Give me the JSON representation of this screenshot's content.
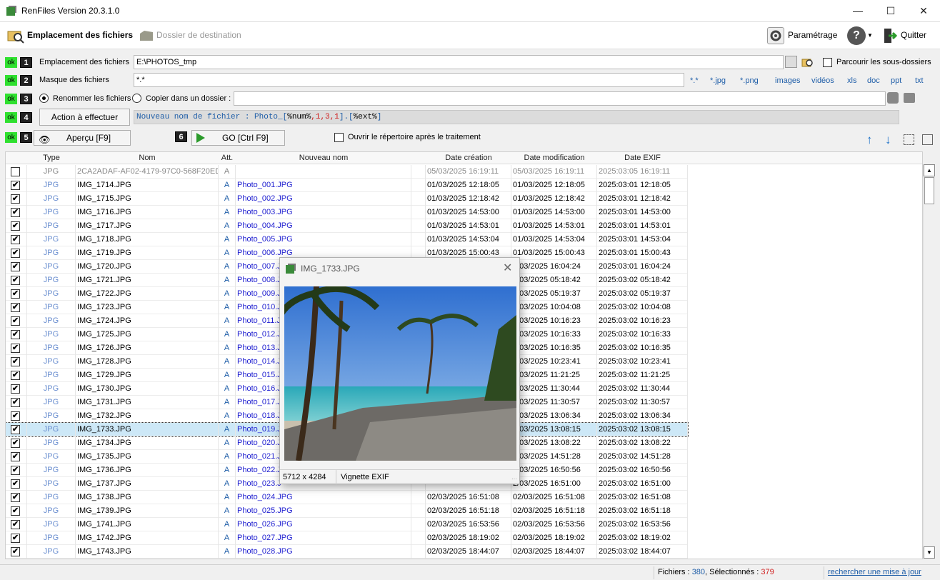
{
  "title": "RenFiles Version 20.3.1.0",
  "toolbar": {
    "location": "Emplacement des fichiers",
    "destination": "Dossier de destination",
    "settings": "Paramétrage",
    "quit": "Quitter"
  },
  "form": {
    "ok": "ok",
    "n1": "1",
    "n2": "2",
    "n3": "3",
    "n4": "4",
    "n5": "5",
    "n6": "6",
    "location_label": "Emplacement des fichiers",
    "location_value": "E:\\PHOTOS_tmp",
    "subfolders": "Parcourir les sous-dossiers",
    "mask_label": "Masque des fichiers",
    "mask_value": "*.*",
    "rename": "Renommer les fichiers",
    "copy": "Copier dans un dossier :",
    "action": "Action à effectuer",
    "formula_prefix": "Nouveau nom de fichier : Photo_[",
    "formula_num": "%num%",
    "formula_args": ",1,3,1",
    "formula_mid": "].[",
    "formula_ext": "%ext%",
    "formula_end": "]",
    "preview": "Aperçu [F9]",
    "go": "GO [Ctrl F9]",
    "open_dir": "Ouvrir le répertoire après le traitement"
  },
  "ext_filters": [
    "*.*",
    "*.jpg",
    "*.png",
    "images",
    "vidéos",
    "xls",
    "doc",
    "ppt",
    "txt"
  ],
  "columns": {
    "type": "Type",
    "name": "Nom",
    "att": "Att.",
    "new": "Nouveau nom",
    "created": "Date création",
    "modified": "Date modification",
    "exif": "Date EXIF"
  },
  "rows": [
    {
      "checked": false,
      "type": "JPG",
      "name": "2CA2ADAF-AF02-4179-97C0-568F20ED4I",
      "att": "A",
      "new": "",
      "created": "05/03/2025 16:19:11",
      "modified": "05/03/2025 16:19:11",
      "exif": "2025:03:05 16:19:11"
    },
    {
      "checked": true,
      "type": "JPG",
      "name": "IMG_1714.JPG",
      "att": "A",
      "new": "Photo_001.JPG",
      "created": "01/03/2025 12:18:05",
      "modified": "01/03/2025 12:18:05",
      "exif": "2025:03:01 12:18:05"
    },
    {
      "checked": true,
      "type": "JPG",
      "name": "IMG_1715.JPG",
      "att": "A",
      "new": "Photo_002.JPG",
      "created": "01/03/2025 12:18:42",
      "modified": "01/03/2025 12:18:42",
      "exif": "2025:03:01 12:18:42"
    },
    {
      "checked": true,
      "type": "JPG",
      "name": "IMG_1716.JPG",
      "att": "A",
      "new": "Photo_003.JPG",
      "created": "01/03/2025 14:53:00",
      "modified": "01/03/2025 14:53:00",
      "exif": "2025:03:01 14:53:00"
    },
    {
      "checked": true,
      "type": "JPG",
      "name": "IMG_1717.JPG",
      "att": "A",
      "new": "Photo_004.JPG",
      "created": "01/03/2025 14:53:01",
      "modified": "01/03/2025 14:53:01",
      "exif": "2025:03:01 14:53:01"
    },
    {
      "checked": true,
      "type": "JPG",
      "name": "IMG_1718.JPG",
      "att": "A",
      "new": "Photo_005.JPG",
      "created": "01/03/2025 14:53:04",
      "modified": "01/03/2025 14:53:04",
      "exif": "2025:03:01 14:53:04"
    },
    {
      "checked": true,
      "type": "JPG",
      "name": "IMG_1719.JPG",
      "att": "A",
      "new": "Photo_006.JPG",
      "created": "01/03/2025 15:00:43",
      "modified": "01/03/2025 15:00:43",
      "exif": "2025:03:01 15:00:43"
    },
    {
      "checked": true,
      "type": "JPG",
      "name": "IMG_1720.JPG",
      "att": "A",
      "new": "Photo_007.J",
      "created": "",
      "modified": "1/03/2025 16:04:24",
      "exif": "2025:03:01 16:04:24"
    },
    {
      "checked": true,
      "type": "JPG",
      "name": "IMG_1721.JPG",
      "att": "A",
      "new": "Photo_008.J",
      "created": "",
      "modified": "2/03/2025 05:18:42",
      "exif": "2025:03:02 05:18:42"
    },
    {
      "checked": true,
      "type": "JPG",
      "name": "IMG_1722.JPG",
      "att": "A",
      "new": "Photo_009.J",
      "created": "",
      "modified": "2/03/2025 05:19:37",
      "exif": "2025:03:02 05:19:37"
    },
    {
      "checked": true,
      "type": "JPG",
      "name": "IMG_1723.JPG",
      "att": "A",
      "new": "Photo_010.J",
      "created": "",
      "modified": "2/03/2025 10:04:08",
      "exif": "2025:03:02 10:04:08"
    },
    {
      "checked": true,
      "type": "JPG",
      "name": "IMG_1724.JPG",
      "att": "A",
      "new": "Photo_011.J",
      "created": "",
      "modified": "2/03/2025 10:16:23",
      "exif": "2025:03:02 10:16:23"
    },
    {
      "checked": true,
      "type": "JPG",
      "name": "IMG_1725.JPG",
      "att": "A",
      "new": "Photo_012.J",
      "created": "",
      "modified": "2/03/2025 10:16:33",
      "exif": "2025:03:02 10:16:33"
    },
    {
      "checked": true,
      "type": "JPG",
      "name": "IMG_1726.JPG",
      "att": "A",
      "new": "Photo_013.J",
      "created": "",
      "modified": "2/03/2025 10:16:35",
      "exif": "2025:03:02 10:16:35"
    },
    {
      "checked": true,
      "type": "JPG",
      "name": "IMG_1728.JPG",
      "att": "A",
      "new": "Photo_014.J",
      "created": "",
      "modified": "2/03/2025 10:23:41",
      "exif": "2025:03:02 10:23:41"
    },
    {
      "checked": true,
      "type": "JPG",
      "name": "IMG_1729.JPG",
      "att": "A",
      "new": "Photo_015.J",
      "created": "",
      "modified": "2/03/2025 11:21:25",
      "exif": "2025:03:02 11:21:25"
    },
    {
      "checked": true,
      "type": "JPG",
      "name": "IMG_1730.JPG",
      "att": "A",
      "new": "Photo_016.J",
      "created": "",
      "modified": "2/03/2025 11:30:44",
      "exif": "2025:03:02 11:30:44"
    },
    {
      "checked": true,
      "type": "JPG",
      "name": "IMG_1731.JPG",
      "att": "A",
      "new": "Photo_017.J",
      "created": "",
      "modified": "2/03/2025 11:30:57",
      "exif": "2025:03:02 11:30:57"
    },
    {
      "checked": true,
      "type": "JPG",
      "name": "IMG_1732.JPG",
      "att": "A",
      "new": "Photo_018.J",
      "created": "",
      "modified": "2/03/2025 13:06:34",
      "exif": "2025:03:02 13:06:34"
    },
    {
      "checked": true,
      "type": "JPG",
      "name": "IMG_1733.JPG",
      "att": "A",
      "new": "Photo_019.J",
      "created": "",
      "modified": "2/03/2025 13:08:15",
      "exif": "2025:03:02 13:08:15",
      "selected": true
    },
    {
      "checked": true,
      "type": "JPG",
      "name": "IMG_1734.JPG",
      "att": "A",
      "new": "Photo_020.J",
      "created": "",
      "modified": "2/03/2025 13:08:22",
      "exif": "2025:03:02 13:08:22"
    },
    {
      "checked": true,
      "type": "JPG",
      "name": "IMG_1735.JPG",
      "att": "A",
      "new": "Photo_021.J",
      "created": "",
      "modified": "2/03/2025 14:51:28",
      "exif": "2025:03:02 14:51:28"
    },
    {
      "checked": true,
      "type": "JPG",
      "name": "IMG_1736.JPG",
      "att": "A",
      "new": "Photo_022.J",
      "created": "",
      "modified": "2/03/2025 16:50:56",
      "exif": "2025:03:02 16:50:56"
    },
    {
      "checked": true,
      "type": "JPG",
      "name": "IMG_1737.JPG",
      "att": "A",
      "new": "Photo_023.J",
      "created": "",
      "modified": "2/03/2025 16:51:00",
      "exif": "2025:03:02 16:51:00"
    },
    {
      "checked": true,
      "type": "JPG",
      "name": "IMG_1738.JPG",
      "att": "A",
      "new": "Photo_024.JPG",
      "created": "02/03/2025 16:51:08",
      "modified": "02/03/2025 16:51:08",
      "exif": "2025:03:02 16:51:08"
    },
    {
      "checked": true,
      "type": "JPG",
      "name": "IMG_1739.JPG",
      "att": "A",
      "new": "Photo_025.JPG",
      "created": "02/03/2025 16:51:18",
      "modified": "02/03/2025 16:51:18",
      "exif": "2025:03:02 16:51:18"
    },
    {
      "checked": true,
      "type": "JPG",
      "name": "IMG_1741.JPG",
      "att": "A",
      "new": "Photo_026.JPG",
      "created": "02/03/2025 16:53:56",
      "modified": "02/03/2025 16:53:56",
      "exif": "2025:03:02 16:53:56"
    },
    {
      "checked": true,
      "type": "JPG",
      "name": "IMG_1742.JPG",
      "att": "A",
      "new": "Photo_027.JPG",
      "created": "02/03/2025 18:19:02",
      "modified": "02/03/2025 18:19:02",
      "exif": "2025:03:02 18:19:02"
    },
    {
      "checked": true,
      "type": "JPG",
      "name": "IMG_1743.JPG",
      "att": "A",
      "new": "Photo_028.JPG",
      "created": "02/03/2025 18:44:07",
      "modified": "02/03/2025 18:44:07",
      "exif": "2025:03:02 18:44:07"
    }
  ],
  "popup": {
    "title": "IMG_1733.JPG",
    "dims": "5712 x 4284",
    "mode": "Vignette EXIF"
  },
  "status": {
    "files_label": "Fichiers : ",
    "files": "380",
    "sel_label": ", Sélectionnés : ",
    "selected": "379",
    "update": "rechercher une mise à jour"
  },
  "colors": {
    "accent": "#1f5ea8",
    "ok": "#2fe02f",
    "selected_count": "#d02020",
    "type_text": "#6b8fd0"
  }
}
